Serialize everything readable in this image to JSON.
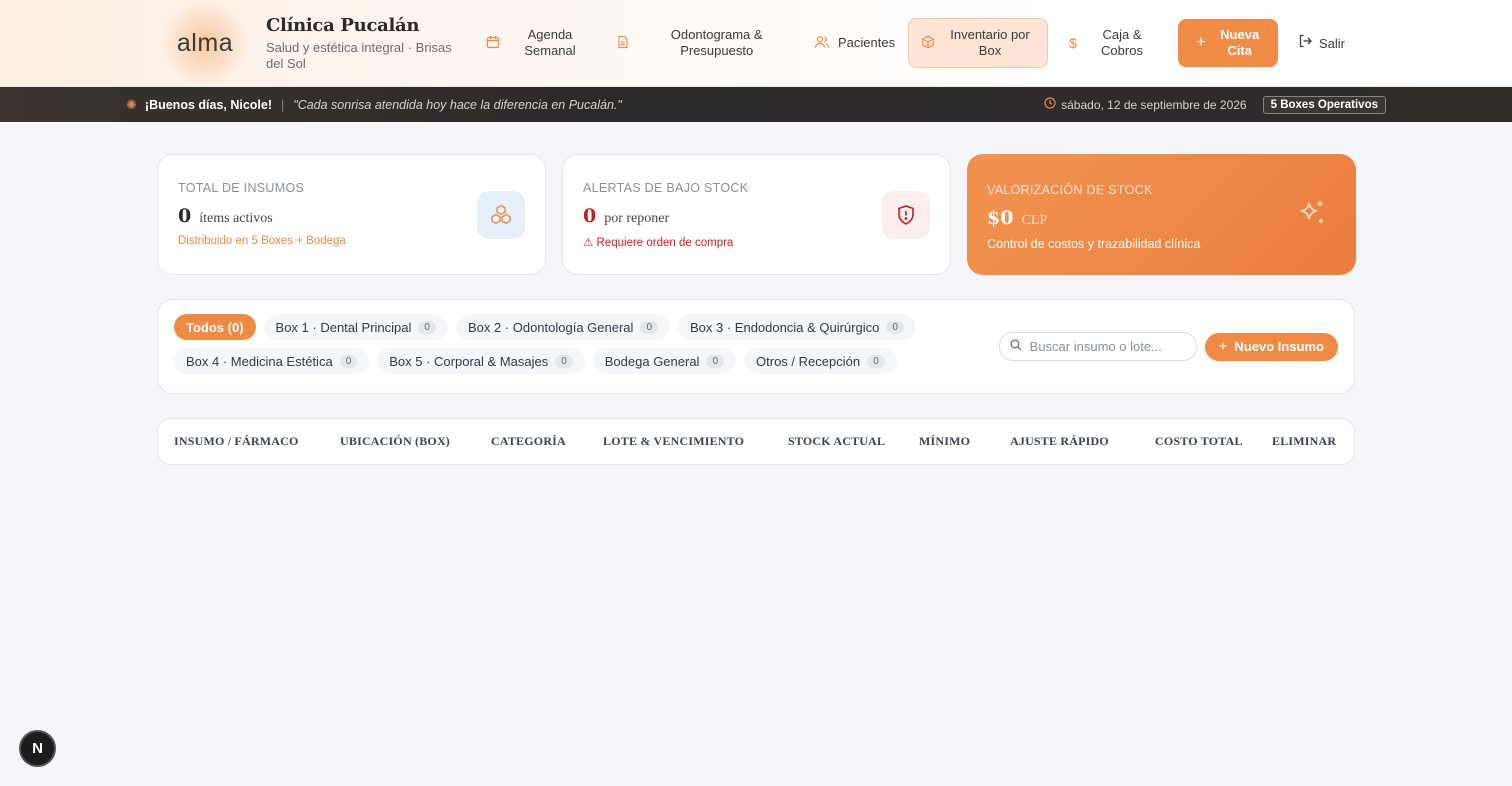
{
  "header": {
    "logo_text": "alma",
    "clinic_title": "Clínica Pucalán",
    "clinic_subtitle": "Salud y estética integral · Brisas del Sol",
    "nav": [
      {
        "label": "Agenda Semanal",
        "icon": "calendar-icon"
      },
      {
        "label": "Odontograma & Presupuesto",
        "icon": "document-icon"
      },
      {
        "label": "Pacientes",
        "icon": "users-icon"
      },
      {
        "label": "Inventario por Box",
        "icon": "box-icon",
        "active": true
      },
      {
        "label": "Caja & Cobros",
        "icon": "dollar-icon"
      }
    ],
    "new_appointment_label": "Nueva Cita",
    "logout_label": "Salir"
  },
  "greeting": {
    "hello": "¡Buenos días, Nicole!",
    "quote": "\"Cada sonrisa atendida hoy hace la diferencia en Pucalán.\"",
    "date": "sábado, 12 de septiembre de 2026",
    "badge": "5 Boxes Operativos"
  },
  "cards": {
    "total": {
      "label": "TOTAL DE INSUMOS",
      "value": "0",
      "unit": "ítems activos",
      "note": "Distribuido en 5 Boxes + Bodega"
    },
    "alerts": {
      "label": "ALERTAS DE BAJO STOCK",
      "value": "0",
      "unit": "por reponer",
      "note": "Requiere orden de compra"
    },
    "valuation": {
      "label": "VALORIZACIÓN DE STOCK",
      "value": "$0",
      "unit": "CLP",
      "note": "Control de costos y trazabilidad clínica"
    }
  },
  "filters": {
    "chips": [
      {
        "label": "Todos (0)",
        "active": true
      },
      {
        "label": "Box 1 · Dental Principal",
        "count": "0"
      },
      {
        "label": "Box 2 · Odontología General",
        "count": "0"
      },
      {
        "label": "Box 3 · Endodoncia & Quirúrgico",
        "count": "0"
      },
      {
        "label": "Box 4 · Medicina Estética",
        "count": "0"
      },
      {
        "label": "Box 5 · Corporal & Masajes",
        "count": "0"
      },
      {
        "label": "Bodega General",
        "count": "0"
      },
      {
        "label": "Otros / Recepción",
        "count": "0"
      }
    ],
    "search_placeholder": "Buscar insumo o lote...",
    "new_item_label": "Nuevo Insumo"
  },
  "table": {
    "columns": [
      "INSUMO / FÁRMACO",
      "UBICACIÓN (BOX)",
      "CATEGORÍA",
      "LOTE & VENCIMIENTO",
      "STOCK ACTUAL",
      "MÍNIMO",
      "AJUSTE RÁPIDO",
      "COSTO TOTAL",
      "ELIMINAR"
    ]
  },
  "floating_button": "N",
  "colors": {
    "accent": "#ef8a45",
    "alert": "#c81e1e",
    "dark_bar": "#2c2a29"
  }
}
